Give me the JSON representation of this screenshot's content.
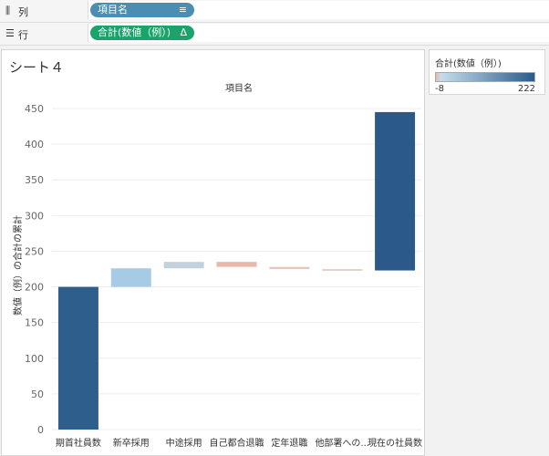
{
  "columns_shelf": {
    "label": "列",
    "pill": "項目名"
  },
  "rows_shelf": {
    "label": "行",
    "pill": "合計(数値（例）)"
  },
  "sheet": {
    "title": "シート４"
  },
  "legend": {
    "title": "合計(数値（例）)",
    "min": "-8",
    "max": "222"
  },
  "colors": {
    "columns_pill": "#4a8fb3",
    "rows_pill": "#1aa36b"
  },
  "chart_data": {
    "type": "bar",
    "subtype": "waterfall",
    "title": "項目名",
    "xlabel": "",
    "ylabel": "数値（例）の合計の累計",
    "ylim": [
      0,
      450
    ],
    "yticks": [
      0,
      50,
      100,
      150,
      200,
      250,
      300,
      350,
      400,
      450
    ],
    "categories": [
      "期首社員数",
      "新卒採用",
      "中途採用",
      "自己都合退職",
      "定年退職",
      "他部署への...",
      "現在の社員数"
    ],
    "bars": [
      {
        "start": 0,
        "end": 200,
        "value": 200,
        "color": "#2e5f8c"
      },
      {
        "start": 200,
        "end": 226,
        "value": 26,
        "color": "#a7cbe5"
      },
      {
        "start": 226,
        "end": 235,
        "value": 9,
        "color": "#c2d1dc"
      },
      {
        "start": 235,
        "end": 228,
        "value": -7,
        "color": "#e8b9ab"
      },
      {
        "start": 228,
        "end": 225,
        "value": -3,
        "color": "#e5c6bc"
      },
      {
        "start": 225,
        "end": 223,
        "value": -2,
        "color": "#e2d1cc"
      },
      {
        "start": 223,
        "end": 445,
        "value": 222,
        "color": "#2b5a8a"
      }
    ],
    "grid": true,
    "legend_position": "right"
  }
}
